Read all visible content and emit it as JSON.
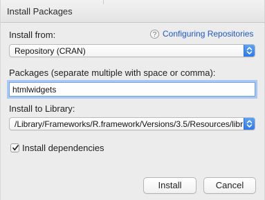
{
  "window": {
    "title": "Install Packages"
  },
  "install_from": {
    "label": "Install from:",
    "help_icon": "question-mark-icon",
    "help_link": "Configuring Repositories",
    "selected": "Repository (CRAN)"
  },
  "packages": {
    "label": "Packages (separate multiple with space or comma):",
    "value": "htmlwidgets"
  },
  "library": {
    "label": "Install to Library:",
    "selected": "/Library/Frameworks/R.framework/Versions/3.5/Resources/libr"
  },
  "dependencies": {
    "label": "Install dependencies",
    "checked": true
  },
  "buttons": {
    "install": "Install",
    "cancel": "Cancel"
  },
  "colors": {
    "link": "#1d57c8",
    "stepper": "#2c79ec",
    "focus_ring": "#a9c8f2"
  }
}
